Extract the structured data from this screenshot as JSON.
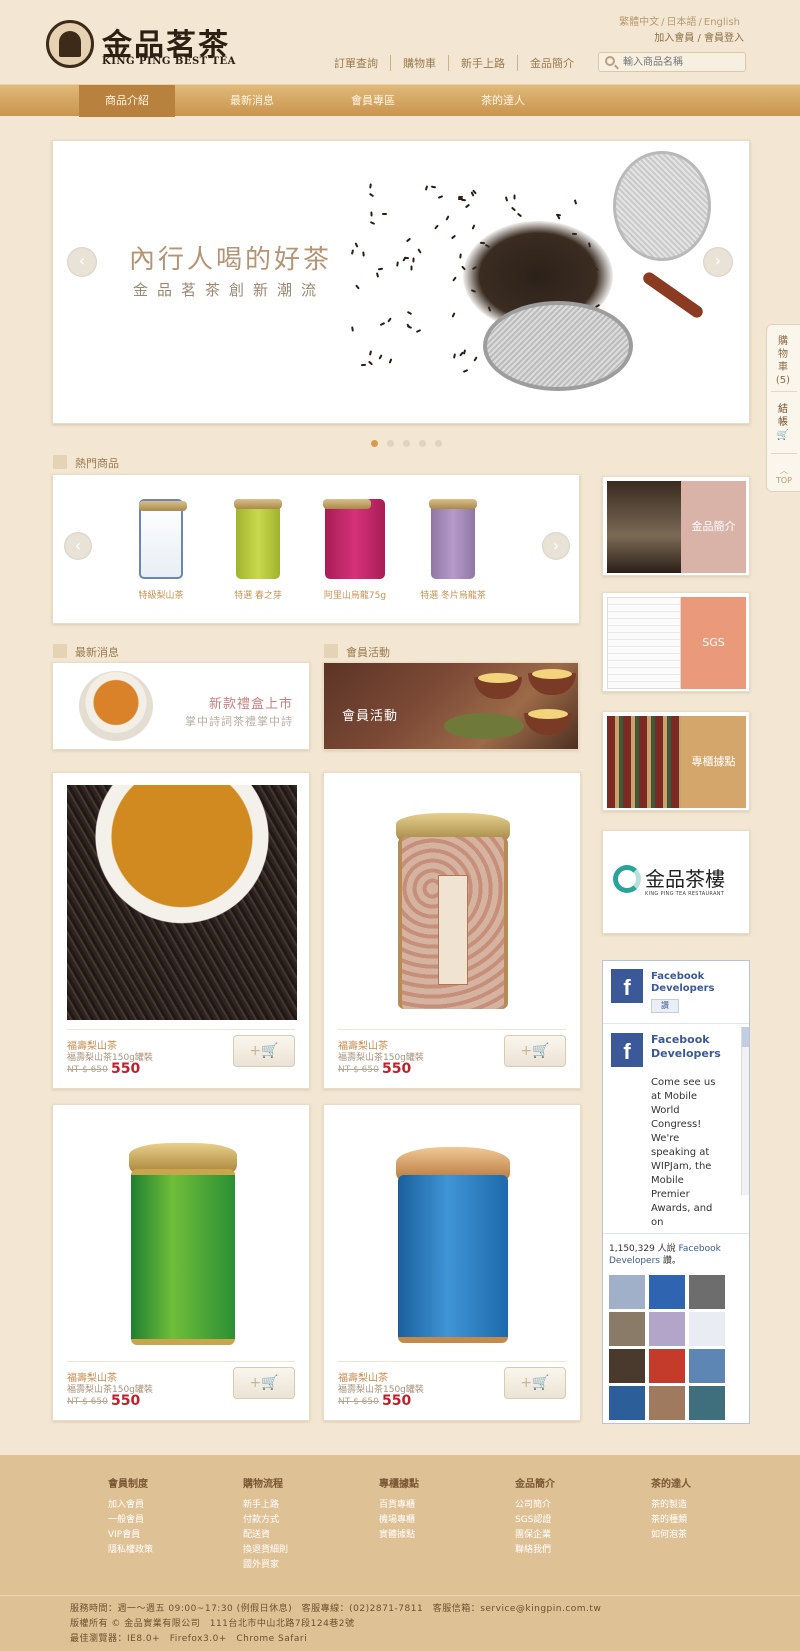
{
  "brand": {
    "name_cn": "金品茗茶",
    "name_en": "KING PING BEST TEA"
  },
  "lang_links": [
    "繁體中文",
    "日本語",
    "English"
  ],
  "account": {
    "join": "加入會員",
    "sep": "/",
    "login": "會員登入"
  },
  "top_nav": [
    "訂單查詢",
    "購物車",
    "新手上路",
    "金品簡介"
  ],
  "search": {
    "placeholder": "輸入商品名稱"
  },
  "main_nav": [
    {
      "label": "商品介紹",
      "active": true
    },
    {
      "label": "最新消息",
      "active": false
    },
    {
      "label": "會員專區",
      "active": false
    },
    {
      "label": "茶的達人",
      "active": false
    }
  ],
  "banner": {
    "title": "內行人喝的好茶",
    "subtitle": "金品茗茶創新潮流",
    "slide_count": 5,
    "current_slide": 1
  },
  "hot_products": {
    "heading": "熱門商品",
    "items": [
      {
        "label": "特級梨山茶",
        "color": "#ffffff"
      },
      {
        "label": "特選 春之芽",
        "color": "#b6c93c"
      },
      {
        "label": "阿里山烏龍75g",
        "color": "#c22a6a"
      },
      {
        "label": "特選 冬片烏龍茶",
        "color": "#a78ab6"
      }
    ]
  },
  "news": {
    "heading": "最新消息",
    "title": "新款禮盒上市",
    "subtitle": "掌中詩詞茶禮掌中詩"
  },
  "member": {
    "heading": "會員活動",
    "label": "會員活動"
  },
  "products": [
    {
      "name": "福壽梨山茶",
      "desc": "福壽梨山茶150g罐裝",
      "old_price": "NT $ 650",
      "price": "550",
      "cart_label": "+🛒",
      "image": "tea-cup-leaves"
    },
    {
      "name": "福壽梨山茶",
      "desc": "福壽梨山茶150g罐裝",
      "old_price": "NT $ 650",
      "price": "550",
      "cart_label": "+🛒",
      "image": "pink-can-oriental-beauty"
    },
    {
      "name": "福壽梨山茶",
      "desc": "福壽梨山茶150g罐裝",
      "old_price": "NT $ 650",
      "price": "550",
      "cart_label": "+🛒",
      "image": "green-can"
    },
    {
      "name": "福壽梨山茶",
      "desc": "福壽梨山茶150g罐裝",
      "old_price": "NT $ 650",
      "price": "550",
      "cart_label": "+🛒",
      "image": "blue-can"
    }
  ],
  "side_links": [
    {
      "label": "金品簡介",
      "color": "#d9b2a8"
    },
    {
      "label": "SGS",
      "color": "#ea9a7a"
    },
    {
      "label": "專櫃據點",
      "color": "#d5a66c"
    }
  ],
  "restaurant": {
    "name_cn": "金品茶樓",
    "name_en": "KING PING TEA RESTAURANT"
  },
  "facebook": {
    "page_name": "Facebook Developers",
    "like_label": "讚",
    "post_author": "Facebook Developers",
    "post_text": "Come see us at Mobile World Congress! We're speaking at WIPJam, the Mobile Premier Awards, and on",
    "count_text": "1,150,329 人說",
    "count_link": "Facebook Developers",
    "count_suffix": "讚。"
  },
  "side_tab": {
    "cart": "購物車",
    "cart_count": "(5)",
    "checkout": "結帳",
    "top": "TOP"
  },
  "footer": {
    "columns": [
      {
        "heading": "會員制度",
        "links": [
          "加入會員",
          "一般會員",
          "VIP會員",
          "隱私權政策"
        ]
      },
      {
        "heading": "購物流程",
        "links": [
          "新手上路",
          "付款方式",
          "配送資",
          "換退貨細則",
          "國外買家"
        ]
      },
      {
        "heading": "專櫃據點",
        "links": [
          "百貨專櫃",
          "機場專櫃",
          "實體據點"
        ]
      },
      {
        "heading": "金品簡介",
        "links": [
          "公司簡介",
          "SGS認證",
          "團保企業",
          "聯絡我們"
        ]
      },
      {
        "heading": "茶的達人",
        "links": [
          "茶的製造",
          "茶的種類",
          "如何泡茶"
        ]
      }
    ],
    "service": "服務時間：週一～週五 09:00~17:30 (例假日休息)　客服專線：(02)2871-7811　客服信箱：service@kingpin.com.tw",
    "copyright": "版權所有 © 金品實業有限公司　111台北市中山北路7段124巷2號",
    "browser": "最佳瀏覽器：IE8.0+　Firefox3.0+　Chrome Safari"
  }
}
